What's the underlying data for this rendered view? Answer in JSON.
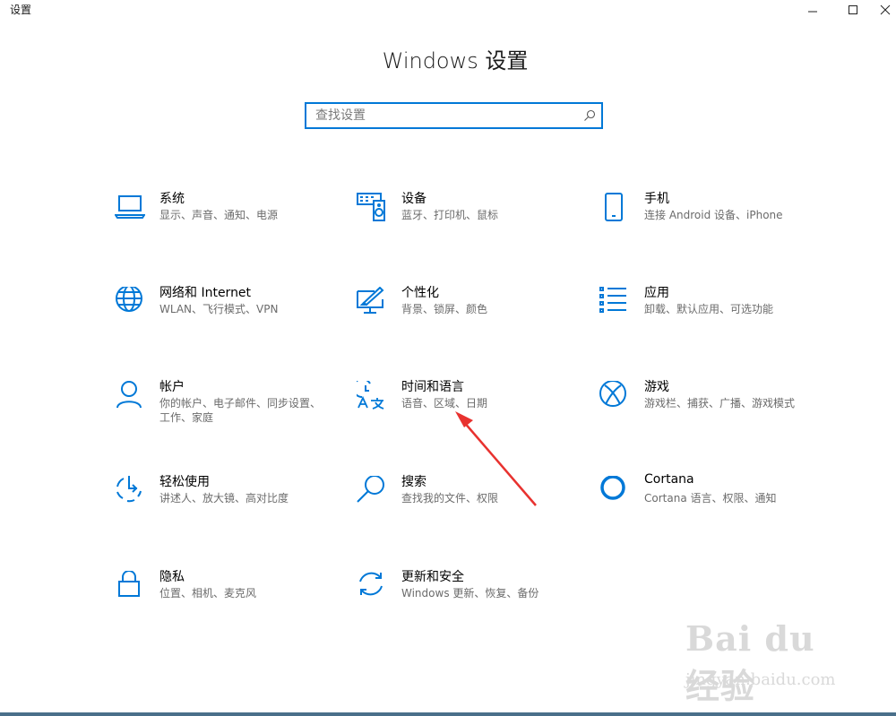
{
  "window": {
    "title": "设置"
  },
  "heading": "Windows 设置",
  "search": {
    "placeholder": "查找设置"
  },
  "tiles": [
    {
      "name": "系统",
      "desc": "显示、声音、通知、电源",
      "icon": "laptop-icon"
    },
    {
      "name": "设备",
      "desc": "蓝牙、打印机、鼠标",
      "icon": "devices-icon"
    },
    {
      "name": "手机",
      "desc": "连接 Android 设备、iPhone",
      "icon": "phone-icon"
    },
    {
      "name": "网络和 Internet",
      "desc": "WLAN、飞行模式、VPN",
      "icon": "globe-icon"
    },
    {
      "name": "个性化",
      "desc": "背景、锁屏、颜色",
      "icon": "personalization-icon"
    },
    {
      "name": "应用",
      "desc": "卸载、默认应用、可选功能",
      "icon": "apps-list-icon"
    },
    {
      "name": "帐户",
      "desc": "你的帐户、电子邮件、同步设置、工作、家庭",
      "icon": "person-icon"
    },
    {
      "name": "时间和语言",
      "desc": "语音、区域、日期",
      "icon": "time-language-icon"
    },
    {
      "name": "游戏",
      "desc": "游戏栏、捕获、广播、游戏模式",
      "icon": "xbox-icon"
    },
    {
      "name": "轻松使用",
      "desc": "讲述人、放大镜、高对比度",
      "icon": "ease-of-access-icon"
    },
    {
      "name": "搜索",
      "desc": "查找我的文件、权限",
      "icon": "search-icon"
    },
    {
      "name": "Cortana",
      "desc": "Cortana 语言、权限、通知",
      "icon": "cortana-icon"
    },
    {
      "name": "隐私",
      "desc": "位置、相机、麦克风",
      "icon": "lock-icon"
    },
    {
      "name": "更新和安全",
      "desc": "Windows 更新、恢复、备份",
      "icon": "update-sync-icon"
    }
  ],
  "watermark": {
    "logo": "Bai du 经验",
    "url": "jingyan.baidu.com"
  },
  "colors": {
    "accent": "#0078d7",
    "annotation_arrow": "#e8322f"
  }
}
